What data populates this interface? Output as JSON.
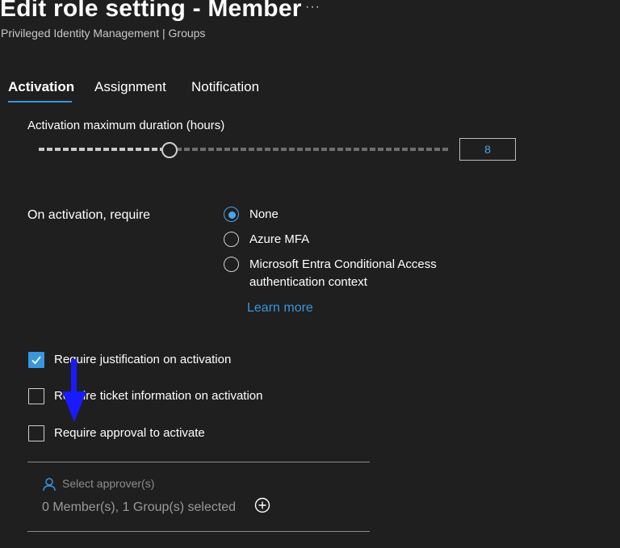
{
  "header": {
    "title": "Edit role setting - Member",
    "more_label": "···",
    "subtitle": "Privileged Identity Management | Groups"
  },
  "tabs": [
    {
      "label": "Activation",
      "active": true
    },
    {
      "label": "Assignment",
      "active": false
    },
    {
      "label": "Notification",
      "active": false
    }
  ],
  "duration": {
    "label": "Activation maximum duration (hours)",
    "value": "8",
    "slider_value": 8,
    "slider_min": 0.5,
    "slider_max": 24
  },
  "activation_require": {
    "label": "On activation, require",
    "options": [
      {
        "label": "None",
        "selected": true
      },
      {
        "label": "Azure MFA",
        "selected": false
      },
      {
        "label": "Microsoft Entra Conditional Access",
        "label_line2": "authentication context",
        "selected": false
      }
    ],
    "learn_more": "Learn more"
  },
  "checks": [
    {
      "label": "Require justification on activation",
      "checked": true
    },
    {
      "label": "Require ticket information on activation",
      "checked": false
    },
    {
      "label": "Require approval to activate",
      "checked": false
    }
  ],
  "approvers": {
    "placeholder": "Select approver(s)",
    "count_text": "0 Member(s), 1 Group(s) selected"
  },
  "colors": {
    "background": "#1f1f1f",
    "accent": "#3a96dd",
    "annotation_arrow": "#1a1aff"
  },
  "icons": [
    "more-icon",
    "person-icon",
    "add-circle-icon",
    "checkmark-icon",
    "down-arrow-icon"
  ]
}
